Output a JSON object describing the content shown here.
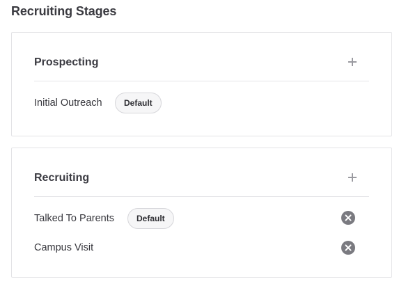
{
  "page": {
    "title": "Recruiting Stages"
  },
  "groups": [
    {
      "title": "Prospecting",
      "add_icon": "plus-icon",
      "stages": [
        {
          "label": "Initial Outreach",
          "badge": "Default",
          "removable": false
        }
      ]
    },
    {
      "title": "Recruiting",
      "add_icon": "plus-icon",
      "stages": [
        {
          "label": "Talked To Parents",
          "badge": "Default",
          "removable": true,
          "remove_icon": "close-circle-icon"
        },
        {
          "label": "Campus Visit",
          "badge": null,
          "removable": true,
          "remove_icon": "close-circle-icon"
        }
      ]
    }
  ],
  "colors": {
    "icon_gray": "#7a7a80",
    "border": "#e3e3e6",
    "badge_bg": "#f6f6f7"
  }
}
